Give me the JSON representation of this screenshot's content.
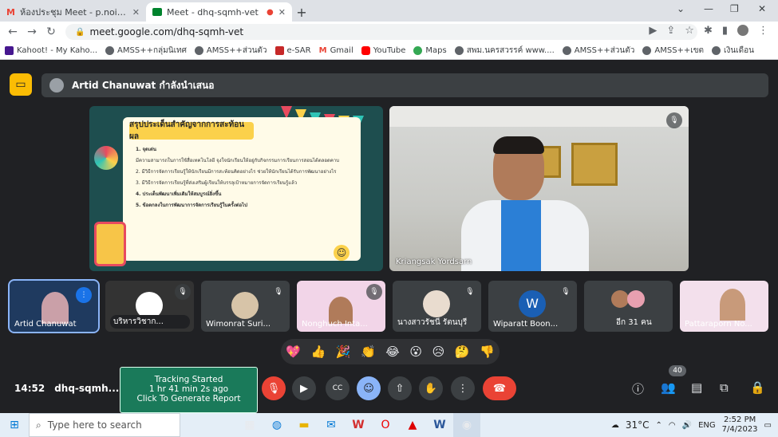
{
  "browser": {
    "tabs": [
      {
        "label": "ห้องประชุม Meet - p.noigor@gmai",
        "icon": "gmail-icon"
      },
      {
        "label": "Meet - dhq-sqmh-vet",
        "icon": "meet-icon"
      }
    ],
    "url": "meet.google.com/dhq-sqmh-vet",
    "bookmarks": [
      "Kahoot! - My Kaho...",
      "AMSS++กลุ่มนิเทศ",
      "AMSS++ส่วนตัว",
      "e-SAR",
      "Gmail",
      "YouTube",
      "Maps",
      "สพม.นครสวรรค์ www....",
      "AMSS++ส่วนตัว",
      "AMSS++เขต",
      "เงินเดือน"
    ]
  },
  "meeting": {
    "presenting_label": "Artid Chanuwat กำลังนำเสนอ",
    "slide": {
      "title": "สรุปประเด็นสำคัญจากการสะท้อนผล",
      "lines": [
        "1. จุดเด่น",
        "มีความสามารถในการใช้สื่อเทคโนโลยี จุงใจนักเรียนให้อยู่กับกิจกรรมการเรียนการสอนได้ตลอดคาบ",
        "2. มีวิธีการจัดการเรียนรู้ให้นักเรียนมีการสะท้อนคิดอย่างไร ช่วยให้นักเรียนได้รับการพัฒนาอย่างไร",
        "3. มีวิธีการจัดการเรียนรู้ที่ส่งเสริมผู้เรียนให้บรรลุเป้าหมายการจัดการเรียนรู้แล้ว",
        "4. ประเด็นพัฒนาเพิ่มเติมให้สมบูรณ์ยิ่งขึ้น",
        "5. ข้อตกลงในการพัฒนาการจัดการเรียนรู้ในครั้งต่อไป"
      ]
    },
    "main_camera_name": "Kriangsak Yordsarn",
    "participants": [
      {
        "name": "Artid Chanuwat"
      },
      {
        "name": "บริหารวิชาก..."
      },
      {
        "name": "Wimonrat Suri..."
      },
      {
        "name": "Nonghuch Inta..."
      },
      {
        "name": "นางสาวรัชนี รัตนบุรี"
      },
      {
        "name": "Wiparatt Boon...",
        "initial": "W"
      },
      {
        "name": "อีก 31 คน"
      },
      {
        "name": "Pattaraporn No..."
      }
    ],
    "reactions": [
      "💖",
      "👍",
      "🎉",
      "👏",
      "😂",
      "😮",
      "😥",
      "🤔",
      "👎"
    ],
    "time": "14:52",
    "meeting_code": "dhq-sqmh...",
    "tracking": {
      "line1": "Tracking Started",
      "line2": "1 hr 41 min 2s ago",
      "line3": "Click To Generate Report"
    },
    "participant_count": "40"
  },
  "taskbar": {
    "search_placeholder": "Type here to search",
    "weather": "31°C",
    "lang": "ENG",
    "time": "2:52 PM",
    "date": "7/4/2023"
  }
}
